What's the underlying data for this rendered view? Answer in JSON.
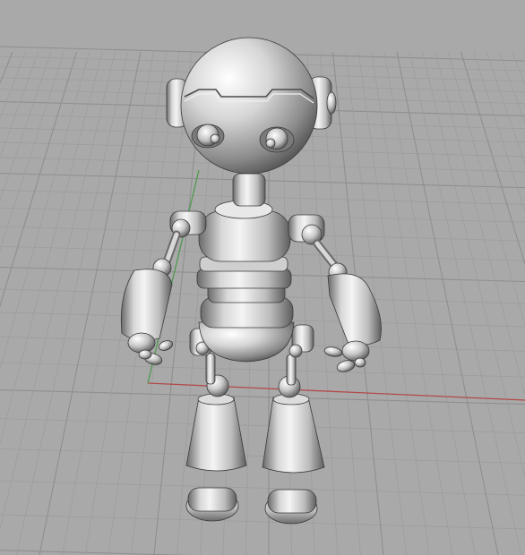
{
  "viewport": {
    "background_color": "#a9a9a9",
    "grid_minor_color": "#9d9d9d",
    "grid_major_color": "#8f8f8f",
    "x_axis_color": "#b24a4a",
    "y_axis_color": "#4f9a4f",
    "model_base_color": "#c9c9c9",
    "model_highlight_color": "#f2f2f2",
    "model_shadow_color": "#6d6d6d",
    "model_outline_color": "#3a3a3a"
  },
  "scene": {
    "model": "robot-figure",
    "shading_mode": "shaded"
  }
}
